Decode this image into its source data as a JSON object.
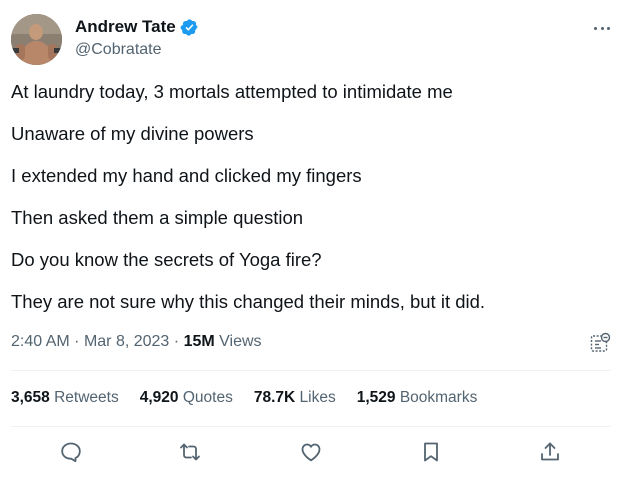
{
  "author": {
    "display_name": "Andrew Tate",
    "handle": "@Cobratate",
    "verified": true,
    "verified_color": "#1d9bf0"
  },
  "more_icon": "more-horizontal-icon",
  "tweet": {
    "lines": [
      "At laundry today, 3 mortals attempted to intimidate me",
      "Unaware of my divine powers",
      "I extended my hand and clicked my fingers",
      "Then asked them a simple question",
      "Do you know the secrets of Yoga fire?",
      "They are not sure why this changed their minds, but it did."
    ]
  },
  "meta": {
    "time": "2:40 AM",
    "separator": "·",
    "date": "Mar 8, 2023",
    "views_count": "15M",
    "views_label": "Views",
    "analytics_icon": "analytics-icon"
  },
  "stats": {
    "retweets_count": "3,658",
    "retweets_label": "Retweets",
    "quotes_count": "4,920",
    "quotes_label": "Quotes",
    "likes_count": "78.7K",
    "likes_label": "Likes",
    "bookmarks_count": "1,529",
    "bookmarks_label": "Bookmarks"
  },
  "actions": [
    "reply-icon",
    "retweet-icon",
    "like-icon",
    "bookmark-icon",
    "share-icon"
  ],
  "colors": {
    "text": "#0f1419",
    "secondary": "#536471",
    "divider": "#eff3f4"
  }
}
